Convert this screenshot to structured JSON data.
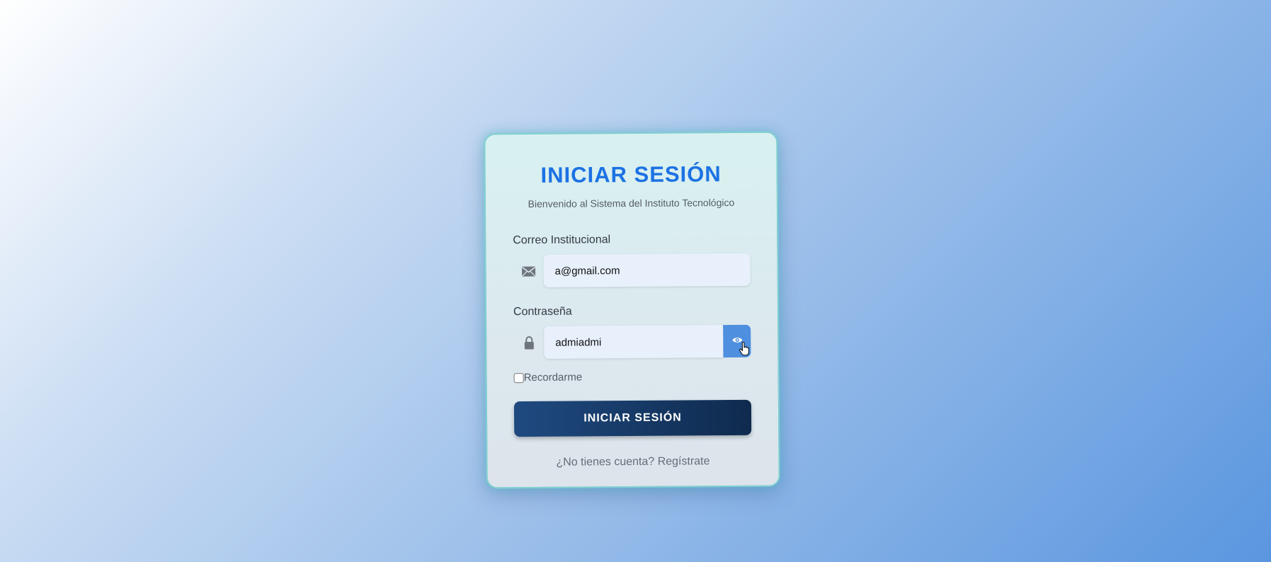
{
  "login": {
    "title": "INICIAR SESIÓN",
    "subtitle": "Bienvenido al Sistema del Instituto Tecnológico",
    "email_label": "Correo Institucional",
    "email_value": "a@gmail.com",
    "password_label": "Contraseña",
    "password_value": "admiadmi",
    "remember_label": "Recordarme",
    "remember_checked": false,
    "submit_label": "INICIAR SESIÓN",
    "register_text": "¿No tienes cuenta? Regístrate"
  },
  "icons": {
    "email": "envelope-icon",
    "password": "lock-icon",
    "toggle": "eye-icon",
    "cursor": "hand-pointer-cursor"
  },
  "colors": {
    "title": "#1c72e3",
    "submit_bg": "#1f4a80",
    "toggle_bg": "#4f8fe0"
  }
}
